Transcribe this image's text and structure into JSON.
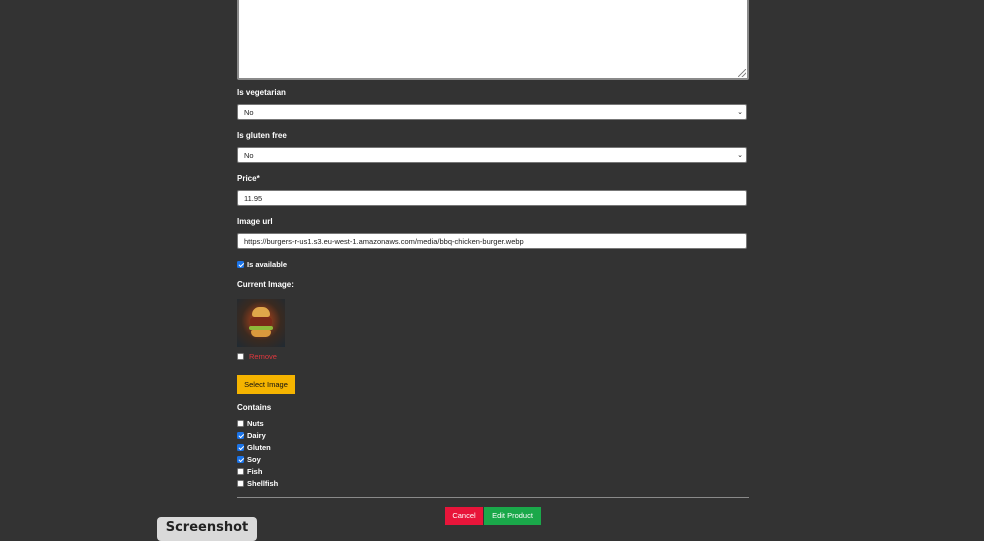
{
  "form": {
    "is_vegetarian": {
      "label": "Is vegetarian",
      "value": "No"
    },
    "is_gluten_free": {
      "label": "Is gluten free",
      "value": "No"
    },
    "price": {
      "label": "Price*",
      "value": "11.95"
    },
    "image_url": {
      "label": "Image url",
      "value": "https://burgers-r-us1.s3.eu-west-1.amazonaws.com/media/bbq-chicken-burger.webp"
    },
    "is_available": {
      "label": "Is available",
      "checked": true
    },
    "current_image": {
      "label": "Current Image:",
      "remove_label": "Remove",
      "remove_checked": false
    },
    "select_image_label": "Select Image",
    "contains": {
      "label": "Contains",
      "items": [
        {
          "label": "Nuts",
          "checked": false
        },
        {
          "label": "Dairy",
          "checked": true
        },
        {
          "label": "Gluten",
          "checked": true
        },
        {
          "label": "Soy",
          "checked": true
        },
        {
          "label": "Fish",
          "checked": false
        },
        {
          "label": "Shellfish",
          "checked": false
        }
      ]
    },
    "cancel_label": "Cancel",
    "submit_label": "Edit Product"
  },
  "screenshot_button_label": "Screenshot",
  "colors": {
    "background": "#333333",
    "cancel": "#e8153a",
    "submit": "#1aa84a",
    "select_image": "#f5b400",
    "remove": "#e0383e"
  }
}
